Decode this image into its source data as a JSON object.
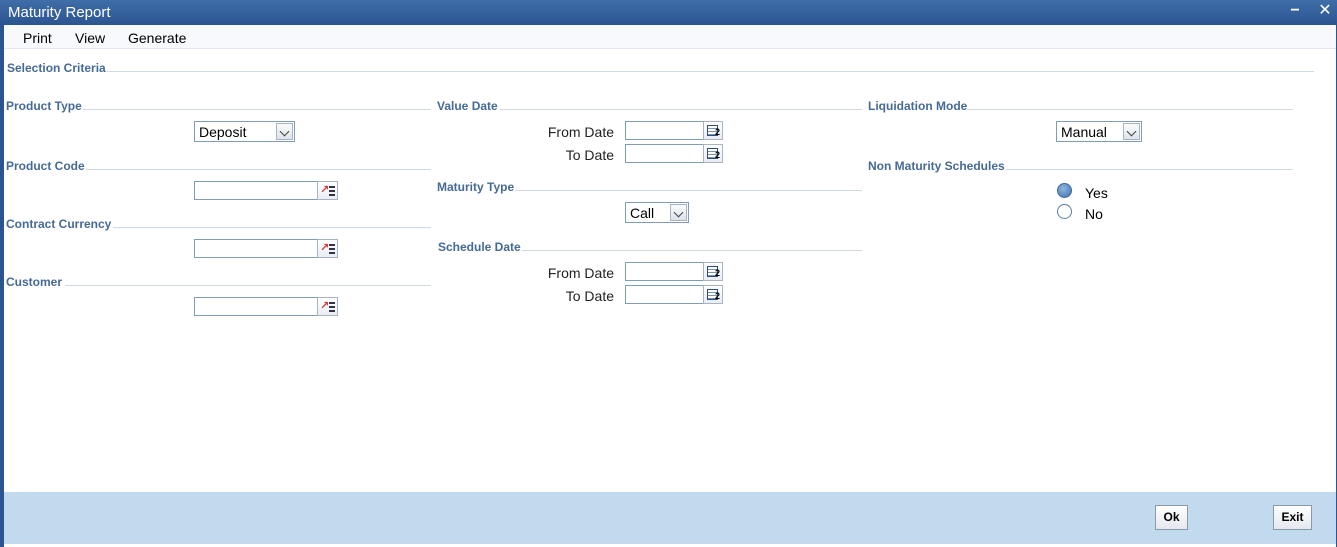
{
  "window": {
    "title": "Maturity Report",
    "minimize_glyph": "−",
    "close_glyph": "✕"
  },
  "menu": {
    "items": [
      "Print",
      "View",
      "Generate"
    ]
  },
  "selection_criteria": {
    "title": "Selection Criteria"
  },
  "product_type": {
    "title": "Product Type",
    "value": "Deposit"
  },
  "product_code": {
    "title": "Product Code",
    "value": ""
  },
  "contract_currency": {
    "title": "Contract Currency",
    "value": ""
  },
  "customer": {
    "title": "Customer",
    "value": ""
  },
  "value_date": {
    "title": "Value Date",
    "from_label": "From Date",
    "to_label": "To Date",
    "from_value": "",
    "to_value": ""
  },
  "maturity_type": {
    "title": "Maturity Type",
    "value": "Call"
  },
  "schedule_date": {
    "title": "Schedule Date",
    "from_label": "From Date",
    "to_label": "To Date",
    "from_value": "",
    "to_value": ""
  },
  "liquidation_mode": {
    "title": "Liquidation Mode",
    "value": "Manual"
  },
  "non_maturity_schedules": {
    "title": "Non Maturity Schedules",
    "options": [
      "Yes",
      "No"
    ],
    "selected": "Yes"
  },
  "footer": {
    "ok_label": "Ok",
    "exit_label": "Exit"
  },
  "icons": {
    "lov": "list-of-values-icon",
    "calendar": "calendar-icon",
    "dropdown": "chevron-down-icon"
  },
  "colors": {
    "title_bar": "#2b5590",
    "section_title": "#466a96",
    "footer_bg": "#c2daee"
  }
}
